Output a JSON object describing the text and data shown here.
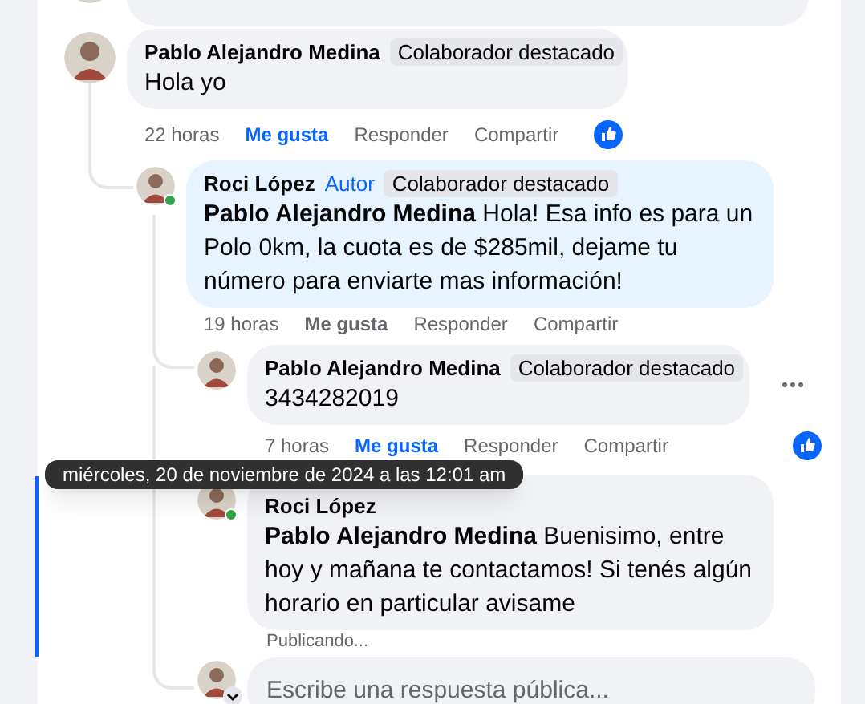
{
  "comments": [
    {
      "kind": "comment",
      "author": "Pablo Alejandro Medina",
      "badge": "Colaborador destacado",
      "online": false,
      "text": "Hola yo",
      "time": "22 horas",
      "actions": [
        "Me gusta",
        "Responder",
        "Compartir"
      ],
      "liked": true,
      "reaction": true,
      "more_menu": false,
      "replies": [
        {
          "kind": "author_reply",
          "author": "Roci López",
          "author_tag": "Autor",
          "badge": "Colaborador destacado",
          "online": true,
          "mention": "Pablo Alejandro Medina",
          "text": "Hola! Esa info es para un Polo 0km, la cuota es de $285mil, dejame tu número para enviarte mas información!",
          "time": "19 horas",
          "actions": [
            "Me gusta",
            "Responder",
            "Compartir"
          ],
          "liked": false,
          "reaction": false,
          "more_menu": false,
          "replies": [
            {
              "kind": "comment",
              "author": "Pablo Alejandro Medina",
              "badge": "Colaborador destacado",
              "online": false,
              "text": "3434282019",
              "time": "7 horas",
              "actions": [
                "Me gusta",
                "Responder",
                "Compartir"
              ],
              "liked": true,
              "reaction": true,
              "more_menu": true
            },
            {
              "kind": "pending",
              "author": "Roci López",
              "online": true,
              "mention": "Pablo Alejandro Medina",
              "text": "Buenisimo, entre hoy y mañana te contactamos! Si tenés algún horario en particular avisame",
              "status": "Publicando..."
            },
            {
              "kind": "reply_box",
              "placeholder": "Escribe una respuesta pública..."
            }
          ]
        }
      ]
    }
  ],
  "tooltip": "miércoles, 20 de noviembre de 2024 a las 12:01 am"
}
